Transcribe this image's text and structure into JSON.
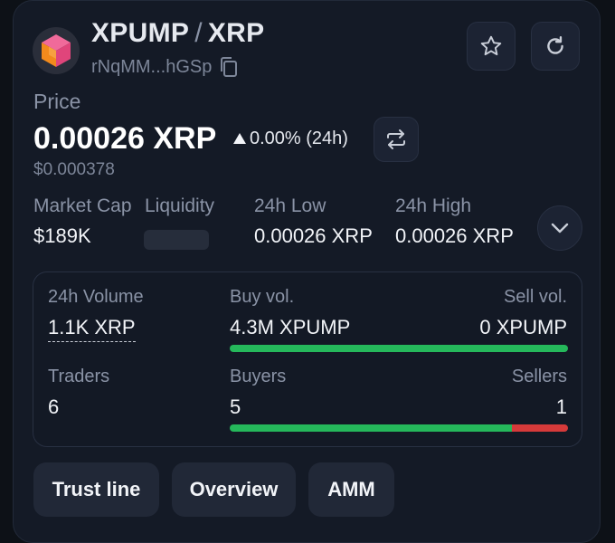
{
  "token": {
    "symbol": "XPUMP",
    "separator": "/",
    "quote": "XRP",
    "address": "rNqMM...hGSp"
  },
  "icons": {
    "logo": "cube-logo-icon",
    "copy": "copy-icon",
    "favorite": "star-icon",
    "refresh": "refresh-icon",
    "swap": "swap-icon",
    "expand": "chevron-down-icon",
    "change_arrow": "triangle-up-icon"
  },
  "price": {
    "label": "Price",
    "value": "0.00026 XRP",
    "change": "0.00% (24h)",
    "usd": "$0.000378"
  },
  "metrics": {
    "market_cap_label": "Market Cap",
    "market_cap_value": "$189K",
    "liquidity_label": "Liquidity",
    "low_label": "24h Low",
    "low_value": "0.00026 XRP",
    "high_label": "24h High",
    "high_value": "0.00026 XRP"
  },
  "stats": {
    "volume_label": "24h Volume",
    "volume_value": "1.1K XRP",
    "buy_vol_label": "Buy vol.",
    "buy_vol_value": "4.3M XPUMP",
    "sell_vol_label": "Sell vol.",
    "sell_vol_value": "0 XPUMP",
    "buy_vol_fraction": 1.0,
    "traders_label": "Traders",
    "traders_value": "6",
    "buyers_label": "Buyers",
    "buyers_value": "5",
    "sellers_label": "Sellers",
    "sellers_value": "1",
    "buyers_fraction": 0.8333
  },
  "tabs": [
    {
      "label": "Trust line"
    },
    {
      "label": "Overview"
    },
    {
      "label": "AMM"
    }
  ],
  "colors": {
    "buy": "#25b85b",
    "sell": "#d63a3a",
    "accent_orange": "#f28a1c",
    "accent_pink": "#e0457b"
  }
}
